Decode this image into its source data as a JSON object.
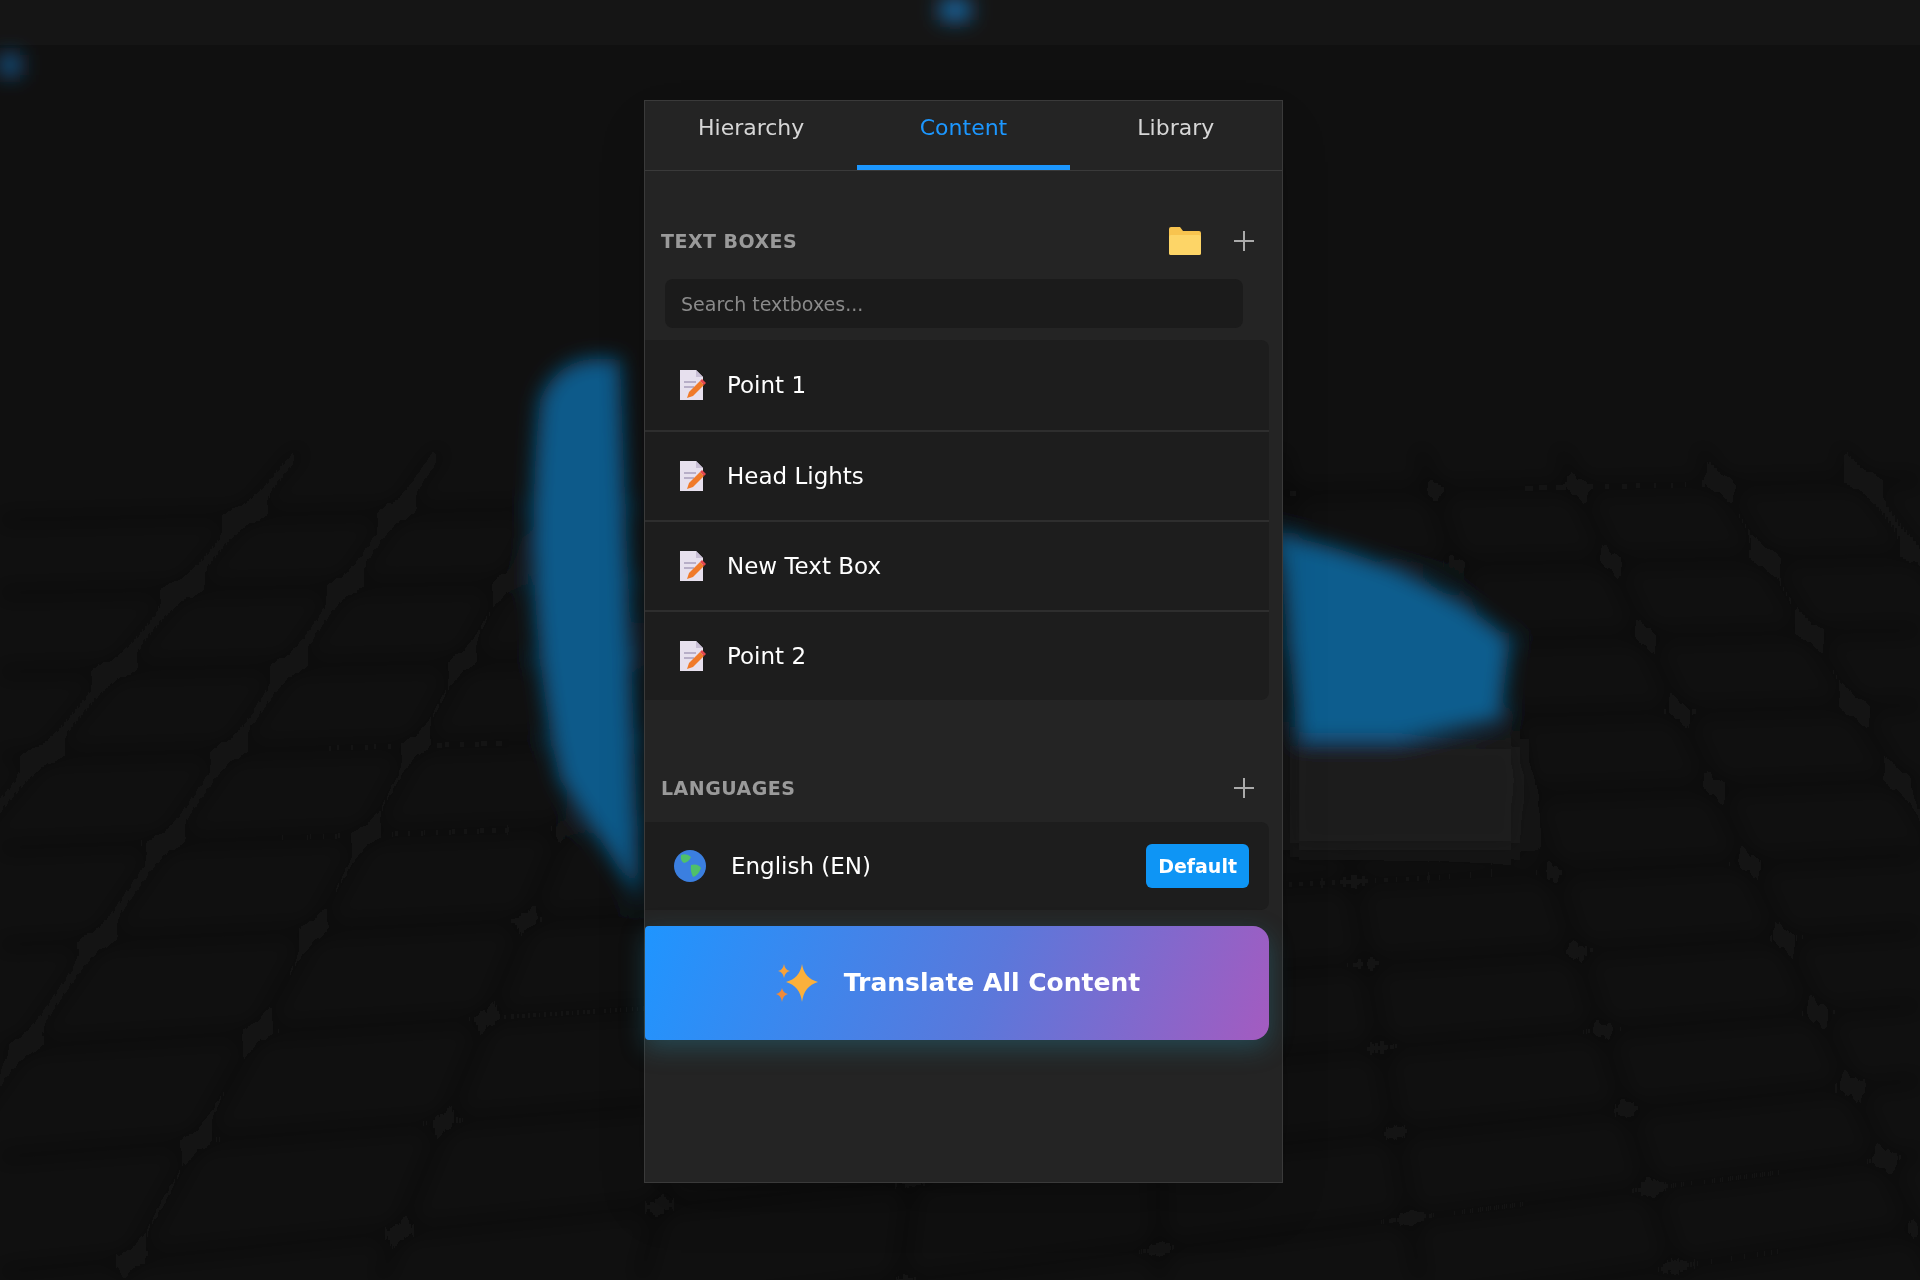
{
  "tabs": [
    {
      "label": "Hierarchy",
      "selected": false
    },
    {
      "label": "Content",
      "selected": true
    },
    {
      "label": "Library",
      "selected": false
    }
  ],
  "text_boxes": {
    "title": "TEXT BOXES",
    "search": {
      "placeholder": "Search textboxes..."
    },
    "items": [
      {
        "label": "Point 1"
      },
      {
        "label": "Head Lights"
      },
      {
        "label": "New Text Box"
      },
      {
        "label": "Point 2"
      }
    ]
  },
  "languages": {
    "title": "LANGUAGES",
    "items": [
      {
        "label": "English (EN)",
        "badge": "Default"
      }
    ]
  },
  "translate_button": {
    "label": "Translate All Content"
  }
}
